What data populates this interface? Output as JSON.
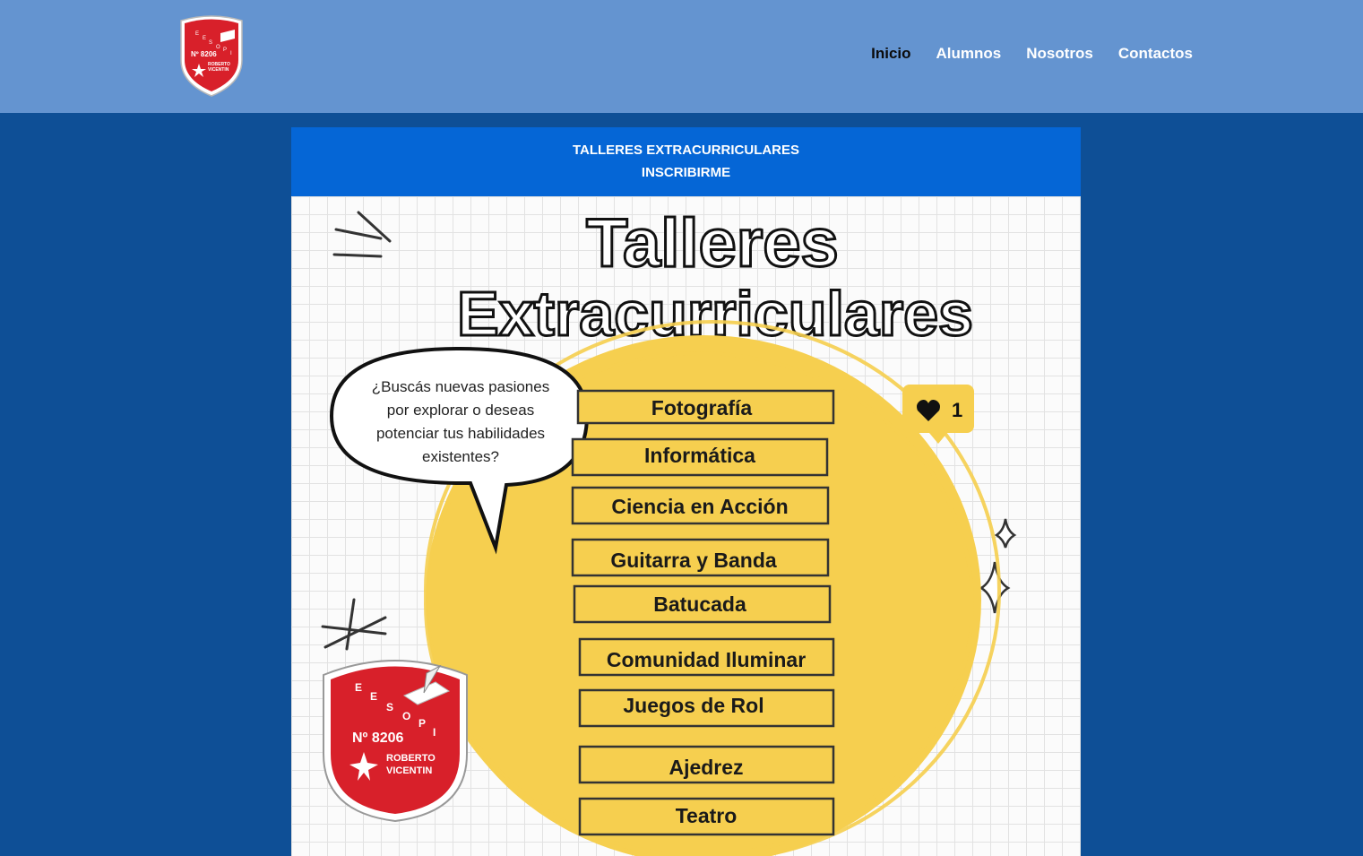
{
  "header": {
    "logo": {
      "line1": "E E S O P I",
      "number": "Nº 8206",
      "name1": "ROBERTO",
      "name2": "VICENTIN"
    },
    "nav": [
      {
        "label": "Inicio"
      },
      {
        "label": "Alumnos"
      },
      {
        "label": "Nosotros"
      },
      {
        "label": "Contactos"
      }
    ]
  },
  "banner": {
    "title": "TALLERES EXTRACURRICULARES",
    "link": "INSCRIBIRME"
  },
  "poster": {
    "title_line1": "Talleres",
    "title_line2": "Extracurriculares",
    "bubble": [
      "¿Buscás  nuevas pasiones",
      "por explorar o deseas",
      "potenciar tus habilidades",
      "existentes?"
    ],
    "likes": "1",
    "workshops": [
      "Fotografía",
      "Informática",
      "Ciencia en Acción",
      "Guitarra y Banda",
      "Batucada",
      "Comunidad Iluminar",
      "Juegos de Rol",
      "Ajedrez",
      "Teatro"
    ],
    "crest": {
      "letters": [
        "E",
        "E",
        "S",
        "O",
        "P",
        "I"
      ],
      "number": "Nº 8206",
      "name1": "ROBERTO",
      "name2": "VICENTIN"
    }
  },
  "colors": {
    "header_bg": "#6494d0",
    "page_bg": "#0e4f96",
    "banner_bg": "#0566d6",
    "yellow": "#f6cf4f",
    "crest_red": "#d8202a"
  }
}
